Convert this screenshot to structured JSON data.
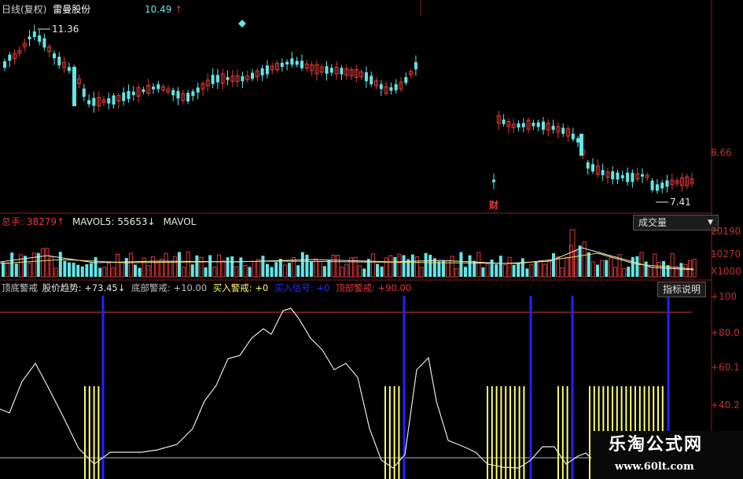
{
  "colors": {
    "up": "#e23a3a",
    "down": "#63e6e6",
    "panel_border": "#8a1b1b",
    "white": "#e8e8e8",
    "yellow": "#ffff66",
    "blue": "#2222ff",
    "axis_text": "#c03030",
    "label_gray": "#d0d0d0"
  },
  "price_panel": {
    "title": "日线(复权)",
    "stock_name": "雷曼股份",
    "price_value": "10.49",
    "price_arrow": "↑",
    "high_marker": "11.36",
    "low_marker": "7.41",
    "finance_marker": "财",
    "axis_label": "8.66"
  },
  "volume_panel": {
    "total_label": "总手: ",
    "total_value": "38279",
    "total_arrow": "↑",
    "mavol5_label": "MAVOL5: ",
    "mavol5_value": "55653",
    "mavol5_arrow": "↓",
    "mavol10_label": "MAVOL",
    "dropdown_label": "成交量",
    "axis_labels": [
      "20190",
      "10270",
      "X1000"
    ]
  },
  "indicator_panel": {
    "name": "顶底警戒",
    "trend_label": "股价趋势: ",
    "trend_value": "+73.45",
    "trend_arrow": "↓",
    "bottom_label": "底部警戒: ",
    "bottom_value": "+10.00",
    "buy_label": "买入警戒: ",
    "buy_value": "+0",
    "signal_label": "买入信号: ",
    "signal_value": "+0",
    "top_label": "顶部警戒: ",
    "top_value": "+90.00",
    "help_button": "指标说明",
    "axis_labels": [
      "+100",
      "+80.0",
      "+60.1",
      "+40.2"
    ]
  },
  "watermark": {
    "title": "乐淘公式网",
    "url": "www.60lt.com"
  }
}
